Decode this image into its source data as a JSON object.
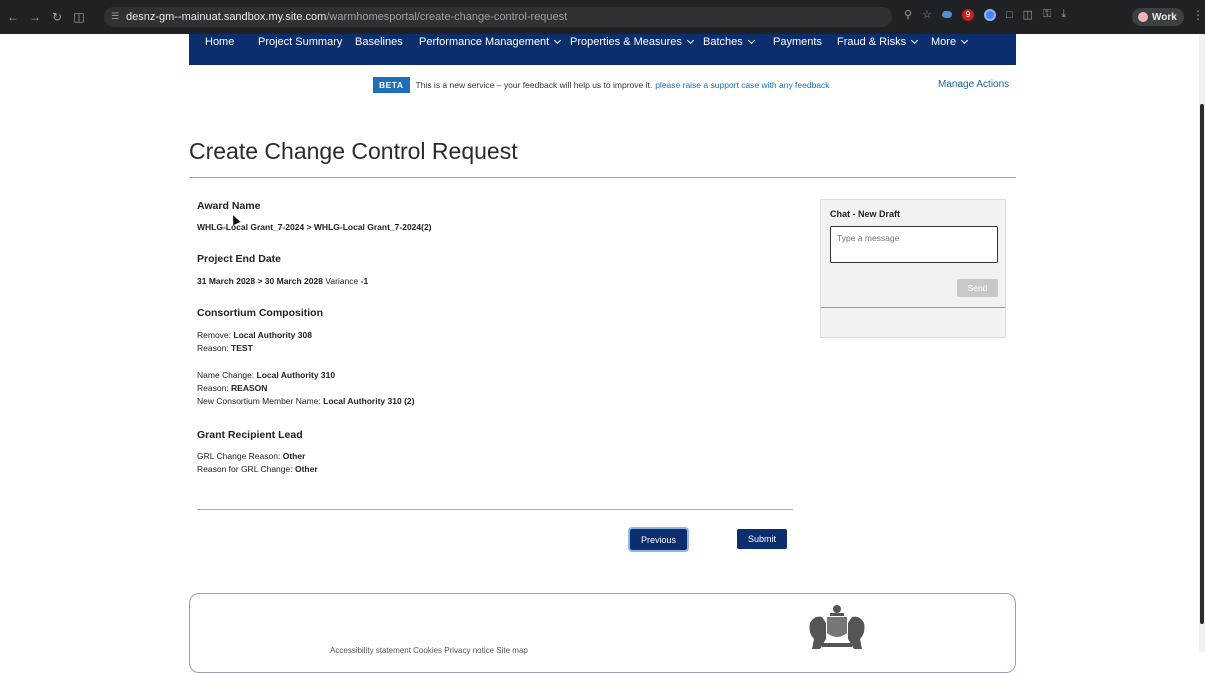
{
  "browser": {
    "url_host": "desnz-gm--mainuat.sandbox.my.site.com",
    "url_path": "/warmhomesportal/create-change-control-request",
    "profile_label": "Work",
    "badge_count": "9"
  },
  "nav": {
    "items": [
      {
        "label": "Home",
        "dropdown": false
      },
      {
        "label": "Project Summary",
        "dropdown": false
      },
      {
        "label": "Baselines",
        "dropdown": false
      },
      {
        "label": "Performance Management",
        "dropdown": true
      },
      {
        "label": "Properties & Measures",
        "dropdown": true
      },
      {
        "label": "Batches",
        "dropdown": true
      },
      {
        "label": "Payments",
        "dropdown": false
      },
      {
        "label": "Fraud & Risks",
        "dropdown": true
      },
      {
        "label": "More",
        "dropdown": true
      }
    ]
  },
  "banner": {
    "tag": "BETA",
    "text": "This is a new service – your feedback will help us to improve it.",
    "link": "please raise a support case with any feedback"
  },
  "manage_actions": "Manage Actions",
  "page_title": "Create Change Control Request",
  "sections": {
    "award": {
      "heading": "Award Name",
      "value": "WHLG-Local Grant_7-2024 > WHLG-Local Grant_7-2024(2)"
    },
    "end_date": {
      "heading": "Project End Date",
      "value": "31 March 2028 > 30 March 2028",
      "variance_label": "Variance",
      "variance_value": "-1"
    },
    "consortium": {
      "heading": "Consortium Composition",
      "remove_label": "Remove:",
      "remove_value": "Local Authority 308",
      "remove_reason_label": "Reason:",
      "remove_reason_value": "TEST",
      "name_change_label": "Name Change:",
      "name_change_value": "Local Authority 310",
      "name_change_reason_label": "Reason:",
      "name_change_reason_value": "REASON",
      "new_member_label": "New Consortium Member Name:",
      "new_member_value": "Local Authority 310 (2)"
    },
    "grl": {
      "heading": "Grant Recipient Lead",
      "change_reason_label": "GRL Change Reason:",
      "change_reason_value": "Other",
      "reason_for_label": "Reason for GRL Change:",
      "reason_for_value": "Other"
    }
  },
  "buttons": {
    "previous": "Previous",
    "submit": "Submit"
  },
  "chat": {
    "title": "Chat - New Draft",
    "placeholder": "Type a message",
    "send": "Send"
  },
  "footer": {
    "links": "Accessibility statement   Cookies   Privacy notice   Site map"
  }
}
